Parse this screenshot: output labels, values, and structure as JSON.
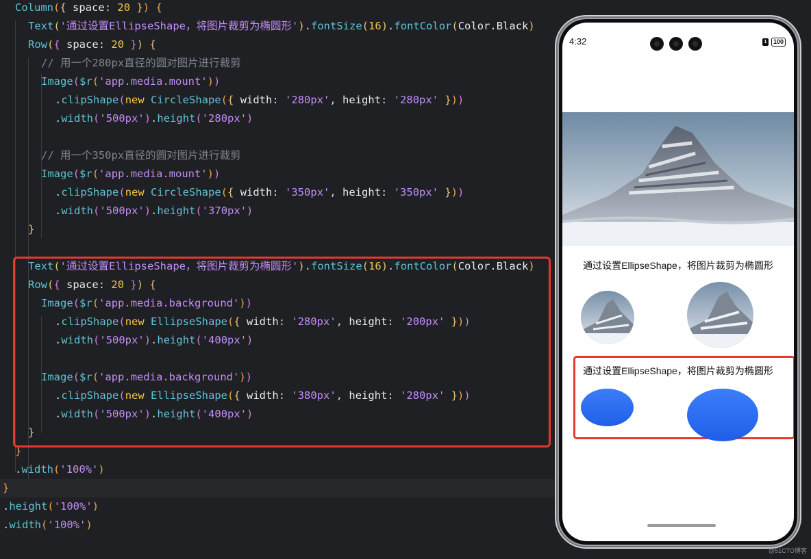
{
  "editor": {
    "lines": [
      [
        [
          "Column",
          "fn"
        ],
        [
          "(",
          "br1"
        ],
        [
          "{ ",
          "br2"
        ],
        [
          "space",
          "arg"
        ],
        [
          ": ",
          "pn"
        ],
        [
          "20",
          "num"
        ],
        [
          " }",
          "br2"
        ],
        [
          ")",
          "br1"
        ],
        [
          " {",
          "br1"
        ]
      ],
      [
        [
          "Text",
          "fn"
        ],
        [
          "(",
          "br2"
        ],
        [
          "'通过设置EllipseShape，将图片裁剪为椭圆形'",
          "str"
        ],
        [
          ")",
          "br2"
        ],
        [
          ".",
          "pn"
        ],
        [
          "fontSize",
          "fn"
        ],
        [
          "(",
          "br2"
        ],
        [
          "16",
          "num"
        ],
        [
          ")",
          "br2"
        ],
        [
          ".",
          "pn"
        ],
        [
          "fontColor",
          "fn"
        ],
        [
          "(",
          "br2"
        ],
        [
          "Color.Black",
          "arg"
        ],
        [
          ")",
          "br2"
        ]
      ],
      [
        [
          "Row",
          "fn"
        ],
        [
          "(",
          "br2"
        ],
        [
          "{ ",
          "br3"
        ],
        [
          "space",
          "arg"
        ],
        [
          ": ",
          "pn"
        ],
        [
          "20",
          "num"
        ],
        [
          " }",
          "br3"
        ],
        [
          ")",
          "br2"
        ],
        [
          " {",
          "br2"
        ]
      ],
      [
        [
          "// 用一个280px直径的圆对图片进行裁剪",
          "cmt"
        ]
      ],
      [
        [
          "Image",
          "fn"
        ],
        [
          "(",
          "br3"
        ],
        [
          "$r",
          "fn"
        ],
        [
          "(",
          "br1"
        ],
        [
          "'app.media.mount'",
          "str"
        ],
        [
          ")",
          "br1"
        ],
        [
          ")",
          "br3"
        ]
      ],
      [
        [
          ".",
          "pn"
        ],
        [
          "clipShape",
          "fn"
        ],
        [
          "(",
          "br3"
        ],
        [
          "new ",
          "kw"
        ],
        [
          "CircleShape",
          "fn"
        ],
        [
          "(",
          "br1"
        ],
        [
          "{ ",
          "br2"
        ],
        [
          "width",
          "arg"
        ],
        [
          ": ",
          "pn"
        ],
        [
          "'280px'",
          "str"
        ],
        [
          ", ",
          "pn"
        ],
        [
          "height",
          "arg"
        ],
        [
          ": ",
          "pn"
        ],
        [
          "'280px'",
          "str"
        ],
        [
          " }",
          "br2"
        ],
        [
          ")",
          "br1"
        ],
        [
          ")",
          "br3"
        ]
      ],
      [
        [
          ".",
          "pn"
        ],
        [
          "width",
          "fn"
        ],
        [
          "(",
          "br3"
        ],
        [
          "'500px'",
          "str"
        ],
        [
          ")",
          "br3"
        ],
        [
          ".",
          "pn"
        ],
        [
          "height",
          "fn"
        ],
        [
          "(",
          "br3"
        ],
        [
          "'280px'",
          "str"
        ],
        [
          ")",
          "br3"
        ]
      ],
      [],
      [
        [
          "// 用一个350px直径的圆对图片进行裁剪",
          "cmt"
        ]
      ],
      [
        [
          "Image",
          "fn"
        ],
        [
          "(",
          "br3"
        ],
        [
          "$r",
          "fn"
        ],
        [
          "(",
          "br1"
        ],
        [
          "'app.media.mount'",
          "str"
        ],
        [
          ")",
          "br1"
        ],
        [
          ")",
          "br3"
        ]
      ],
      [
        [
          ".",
          "pn"
        ],
        [
          "clipShape",
          "fn"
        ],
        [
          "(",
          "br3"
        ],
        [
          "new ",
          "kw"
        ],
        [
          "CircleShape",
          "fn"
        ],
        [
          "(",
          "br1"
        ],
        [
          "{ ",
          "br2"
        ],
        [
          "width",
          "arg"
        ],
        [
          ": ",
          "pn"
        ],
        [
          "'350px'",
          "str"
        ],
        [
          ", ",
          "pn"
        ],
        [
          "height",
          "arg"
        ],
        [
          ": ",
          "pn"
        ],
        [
          "'350px'",
          "str"
        ],
        [
          " }",
          "br2"
        ],
        [
          ")",
          "br1"
        ],
        [
          ")",
          "br3"
        ]
      ],
      [
        [
          ".",
          "pn"
        ],
        [
          "width",
          "fn"
        ],
        [
          "(",
          "br3"
        ],
        [
          "'500px'",
          "str"
        ],
        [
          ")",
          "br3"
        ],
        [
          ".",
          "pn"
        ],
        [
          "height",
          "fn"
        ],
        [
          "(",
          "br3"
        ],
        [
          "'370px'",
          "str"
        ],
        [
          ")",
          "br3"
        ]
      ],
      [
        [
          "}",
          "br2"
        ]
      ],
      [],
      [
        [
          "Text",
          "fn"
        ],
        [
          "(",
          "br2"
        ],
        [
          "'通过设置EllipseShape，将图片裁剪为椭圆形'",
          "str"
        ],
        [
          ")",
          "br2"
        ],
        [
          ".",
          "pn"
        ],
        [
          "fontSize",
          "fn"
        ],
        [
          "(",
          "br2"
        ],
        [
          "16",
          "num"
        ],
        [
          ")",
          "br2"
        ],
        [
          ".",
          "pn"
        ],
        [
          "fontColor",
          "fn"
        ],
        [
          "(",
          "br2"
        ],
        [
          "Color.Black",
          "arg"
        ],
        [
          ")",
          "br2"
        ]
      ],
      [
        [
          "Row",
          "fn"
        ],
        [
          "(",
          "br2"
        ],
        [
          "{ ",
          "br3"
        ],
        [
          "space",
          "arg"
        ],
        [
          ": ",
          "pn"
        ],
        [
          "20",
          "num"
        ],
        [
          " }",
          "br3"
        ],
        [
          ")",
          "br2"
        ],
        [
          " {",
          "br2"
        ]
      ],
      [
        [
          "Image",
          "fn"
        ],
        [
          "(",
          "br3"
        ],
        [
          "$r",
          "fn"
        ],
        [
          "(",
          "br1"
        ],
        [
          "'app.media.background'",
          "str"
        ],
        [
          ")",
          "br1"
        ],
        [
          ")",
          "br3"
        ]
      ],
      [
        [
          ".",
          "pn"
        ],
        [
          "clipShape",
          "fn"
        ],
        [
          "(",
          "br3"
        ],
        [
          "new ",
          "kw"
        ],
        [
          "EllipseShape",
          "fn"
        ],
        [
          "(",
          "br1"
        ],
        [
          "{ ",
          "br2"
        ],
        [
          "width",
          "arg"
        ],
        [
          ": ",
          "pn"
        ],
        [
          "'280px'",
          "str"
        ],
        [
          ", ",
          "pn"
        ],
        [
          "height",
          "arg"
        ],
        [
          ": ",
          "pn"
        ],
        [
          "'200px'",
          "str"
        ],
        [
          " }",
          "br2"
        ],
        [
          ")",
          "br1"
        ],
        [
          ")",
          "br3"
        ]
      ],
      [
        [
          ".",
          "pn"
        ],
        [
          "width",
          "fn"
        ],
        [
          "(",
          "br3"
        ],
        [
          "'500px'",
          "str"
        ],
        [
          ")",
          "br3"
        ],
        [
          ".",
          "pn"
        ],
        [
          "height",
          "fn"
        ],
        [
          "(",
          "br3"
        ],
        [
          "'400px'",
          "str"
        ],
        [
          ")",
          "br3"
        ]
      ],
      [],
      [
        [
          "Image",
          "fn"
        ],
        [
          "(",
          "br3"
        ],
        [
          "$r",
          "fn"
        ],
        [
          "(",
          "br1"
        ],
        [
          "'app.media.background'",
          "str"
        ],
        [
          ")",
          "br1"
        ],
        [
          ")",
          "br3"
        ]
      ],
      [
        [
          ".",
          "pn"
        ],
        [
          "clipShape",
          "fn"
        ],
        [
          "(",
          "br3"
        ],
        [
          "new ",
          "kw"
        ],
        [
          "EllipseShape",
          "fn"
        ],
        [
          "(",
          "br1"
        ],
        [
          "{ ",
          "br2"
        ],
        [
          "width",
          "arg"
        ],
        [
          ": ",
          "pn"
        ],
        [
          "'380px'",
          "str"
        ],
        [
          ", ",
          "pn"
        ],
        [
          "height",
          "arg"
        ],
        [
          ": ",
          "pn"
        ],
        [
          "'280px'",
          "str"
        ],
        [
          " }",
          "br2"
        ],
        [
          ")",
          "br1"
        ],
        [
          ")",
          "br3"
        ]
      ],
      [
        [
          ".",
          "pn"
        ],
        [
          "width",
          "fn"
        ],
        [
          "(",
          "br3"
        ],
        [
          "'500px'",
          "str"
        ],
        [
          ")",
          "br3"
        ],
        [
          ".",
          "pn"
        ],
        [
          "height",
          "fn"
        ],
        [
          "(",
          "br3"
        ],
        [
          "'400px'",
          "str"
        ],
        [
          ")",
          "br3"
        ]
      ],
      [
        [
          "}",
          "br2"
        ]
      ],
      [
        [
          "}",
          "br1"
        ]
      ],
      [
        [
          ".",
          "pn"
        ],
        [
          "width",
          "fn"
        ],
        [
          "(",
          "br1"
        ],
        [
          "'100%'",
          "str"
        ],
        [
          ")",
          "br1"
        ]
      ],
      [
        [
          "}",
          "br1"
        ]
      ],
      [
        [
          ".",
          "pn"
        ],
        [
          "height",
          "fn"
        ],
        [
          "(",
          "br1"
        ],
        [
          "'100%'",
          "str"
        ],
        [
          ")",
          "br1"
        ]
      ],
      [
        [
          ".",
          "pn"
        ],
        [
          "width",
          "fn"
        ],
        [
          "(",
          "br1"
        ],
        [
          "'100%'",
          "str"
        ],
        [
          ")",
          "br1"
        ]
      ]
    ]
  },
  "phone": {
    "status_time": "4:32",
    "battery": "100",
    "sim_label": "1",
    "caption_1": "通过设置EllipseShape，将图片裁剪为椭圆形",
    "caption_2": "通过设置EllipseShape，将图片裁剪为椭圆形",
    "ellipse_color": "#2563eb"
  },
  "watermark": "@51CTO博客"
}
